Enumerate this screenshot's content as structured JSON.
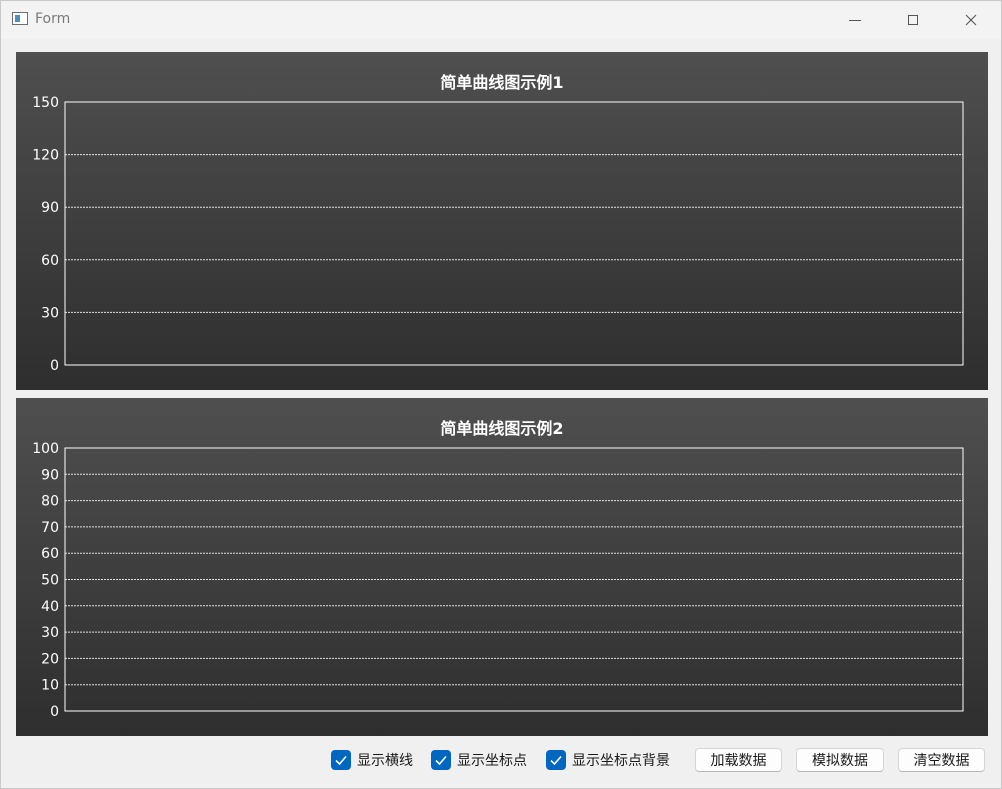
{
  "window": {
    "title": "Form",
    "controls": {
      "minimize": "minimize-icon",
      "maximize": "maximize-icon",
      "close": "close-icon"
    }
  },
  "colors": {
    "panel_top": "#4f4f4f",
    "panel_bottom": "#2e2e2e",
    "axis": "#ffffff",
    "grid": "#ffffff",
    "checkbox_accent": "#0067c0"
  },
  "chart_data": [
    {
      "type": "line",
      "title": "简单曲线图示例1",
      "xlabel": "",
      "ylabel": "",
      "ylim": [
        0,
        150
      ],
      "yticks": [
        0,
        30,
        60,
        90,
        120,
        150
      ],
      "grid": true,
      "series": []
    },
    {
      "type": "line",
      "title": "简单曲线图示例2",
      "xlabel": "",
      "ylabel": "",
      "ylim": [
        0,
        100
      ],
      "yticks": [
        0,
        10,
        20,
        30,
        40,
        50,
        60,
        70,
        80,
        90,
        100
      ],
      "grid": true,
      "series": []
    }
  ],
  "controls": {
    "show_hline": {
      "label": "显示横线",
      "checked": true
    },
    "show_points": {
      "label": "显示坐标点",
      "checked": true
    },
    "show_point_bg": {
      "label": "显示坐标点背景",
      "checked": true
    },
    "load_data_label": "加载数据",
    "simulate_data_label": "模拟数据",
    "clear_data_label": "清空数据"
  }
}
